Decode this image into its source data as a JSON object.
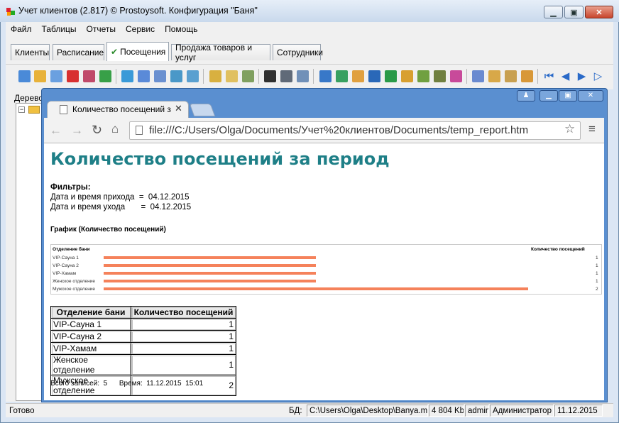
{
  "window": {
    "title": "Учет клиентов (2.817) © Prostoysoft. Конфигурация \"Баня\""
  },
  "menu": [
    "Файл",
    "Таблицы",
    "Отчеты",
    "Сервис",
    "Помощь"
  ],
  "tabs": [
    {
      "label": "Клиенты",
      "active": false
    },
    {
      "label": "Расписание",
      "active": false
    },
    {
      "label": "Посещения",
      "active": true
    },
    {
      "label": "Продажа товаров и услуг",
      "active": false
    },
    {
      "label": "Сотрудники",
      "active": false
    }
  ],
  "left_pane": {
    "label": "Дерево"
  },
  "browser": {
    "tab_title": "Количество посещений з",
    "url": "file:///C:/Users/Olga/Documents/Учет%20клиентов/Documents/temp_report.htm"
  },
  "report": {
    "title": "Количество посещений за период",
    "filters_heading": "Фильтры:",
    "filter1": "Дата и время прихода  =  04.12.2015",
    "filter2": "Дата и время ухода       =  04.12.2015",
    "chart_heading": "График (Количество посещений)",
    "table_headers": [
      "Отделение бани",
      "Количество посещений"
    ],
    "rows": [
      {
        "name": "VIP-Сауна 1",
        "count": "1"
      },
      {
        "name": "VIP-Сауна 2",
        "count": "1"
      },
      {
        "name": "VIP-Хамам",
        "count": "1"
      },
      {
        "name": "Женское отделение",
        "count": "1"
      },
      {
        "name": "Мужское отделение",
        "count": "2"
      }
    ],
    "footer": "Всего записей:  5      Время:  11.12.2015  15:01"
  },
  "chart_data": {
    "type": "bar",
    "orientation": "horizontal",
    "xlabel_left": "Отделение бани",
    "ylabel_right": "Количество посещений",
    "categories": [
      "VIP-Сауна 1",
      "VIP-Сауна 2",
      "VIP-Хамам",
      "Женское отделение",
      "Мужское отделение"
    ],
    "values": [
      1,
      1,
      1,
      1,
      2
    ],
    "value_max": 2,
    "bar_color": "#f5825b"
  },
  "status": {
    "ready": "Готово",
    "db_label": "БД:",
    "db_path": "C:\\Users\\Olga\\Desktop\\Banya.mdb",
    "size": "4 804 Kb",
    "user": "admin",
    "role": "Администратор",
    "date": "11.12.2015"
  },
  "colors": {
    "accent": "#1e7f87",
    "bar": "#f5825b"
  }
}
